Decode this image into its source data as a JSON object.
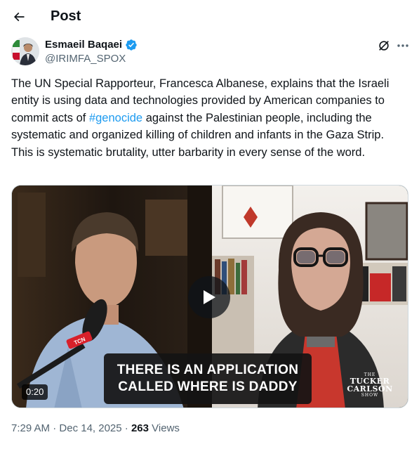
{
  "header": {
    "title": "Post",
    "back_icon": "back-arrow-icon"
  },
  "author": {
    "name": "Esmaeil Baqaei",
    "handle": "@IRIMFA_SPOX",
    "verified": true,
    "verified_color": "#1d9bf0",
    "grok_icon": "grok-icon",
    "more_icon": "more-dots-icon"
  },
  "tweet": {
    "line1_before_hashtag": "The UN Special Rapporteur, Francesca Albanese, explains that the Israeli entity is using data and technologies provided by American companies to commit acts of ",
    "hashtag": "#genocide",
    "line1_after_hashtag": " against the Palestinian people, including the systematic and organized killing of children and infants in the Gaza Strip.",
    "line2": "This is systematic brutality, utter barbarity in every sense of the word."
  },
  "media": {
    "caption_line1": "THERE IS AN APPLICATION",
    "caption_line2": "CALLED WHERE IS DADDY",
    "duration": "0:20",
    "play_icon": "play-icon",
    "logo_the": "THE",
    "logo_line1": "TUCKER",
    "logo_line2": "CARLSON",
    "logo_show": "SHOW",
    "mic_logo_text": "TCN"
  },
  "meta": {
    "time": "7:29 AM",
    "separator": " · ",
    "date": "Dec 14, 2025",
    "views_count": "263",
    "views_label": " Views"
  },
  "colors": {
    "accent": "#1d9bf0",
    "text": "#0f1419",
    "secondary": "#536471"
  }
}
